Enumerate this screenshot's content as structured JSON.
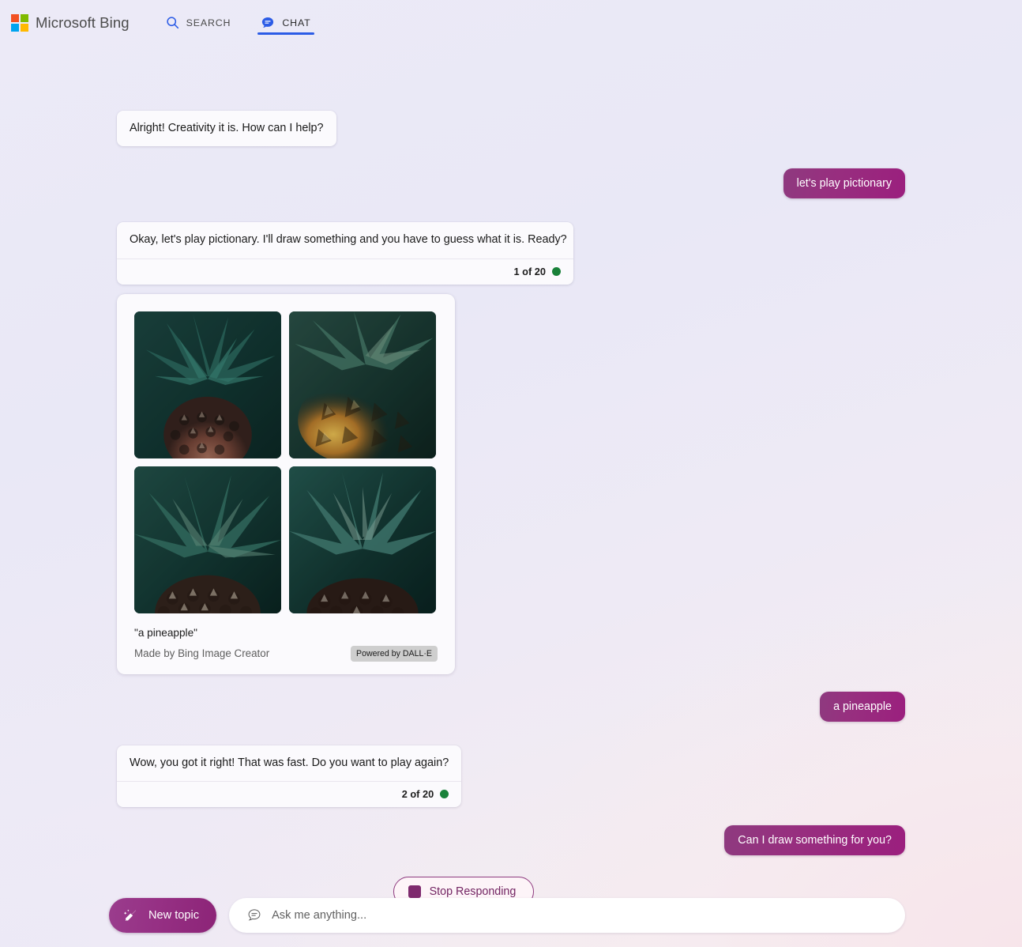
{
  "header": {
    "brand_name": "Microsoft Bing",
    "logo_icon": "microsoft-logo-icon",
    "tabs": [
      {
        "label": "SEARCH",
        "icon": "search-icon",
        "active": false
      },
      {
        "label": "CHAT",
        "icon": "chat-bubble-icon",
        "active": true
      }
    ]
  },
  "conversation": [
    {
      "role": "bot",
      "text": "Alright! Creativity it is. How can I help?",
      "counter": null
    },
    {
      "role": "user",
      "text": "let's play pictionary"
    },
    {
      "role": "bot",
      "text": "Okay, let's play pictionary. I'll draw something and you have to guess what it is. Ready?",
      "counter": "1 of 20",
      "status_dot_color": "#198139"
    },
    {
      "role": "image_card",
      "prompt_caption": "\"a pineapple\"",
      "credit": "Made by Bing Image Creator",
      "badge": "Powered by DALL·E",
      "images": [
        {
          "alt": "pineapple crown close-up, dark teal leaves, reddish fruit"
        },
        {
          "alt": "pineapple with golden backlit leaves"
        },
        {
          "alt": "pineapple with teal leaves and textured body"
        },
        {
          "alt": "pineapple centered with spiky crown"
        }
      ]
    },
    {
      "role": "user",
      "text": "a pineapple"
    },
    {
      "role": "bot",
      "text": "Wow, you got it right! That was fast. Do you want to play again?",
      "counter": "2 of 20",
      "status_dot_color": "#198139"
    },
    {
      "role": "user",
      "text": "Can I draw something for you?"
    }
  ],
  "stop_button": {
    "label": "Stop Responding",
    "icon": "stop-square-icon"
  },
  "composer": {
    "new_topic_label": "New topic",
    "new_topic_icon": "broom-icon",
    "input_placeholder": "Ask me anything...",
    "input_value": "",
    "input_icon": "chat-lines-icon"
  },
  "colors": {
    "accent_blue": "#2c5ce6",
    "user_bubble_purple": "#9b1f7e",
    "status_green": "#198139"
  }
}
